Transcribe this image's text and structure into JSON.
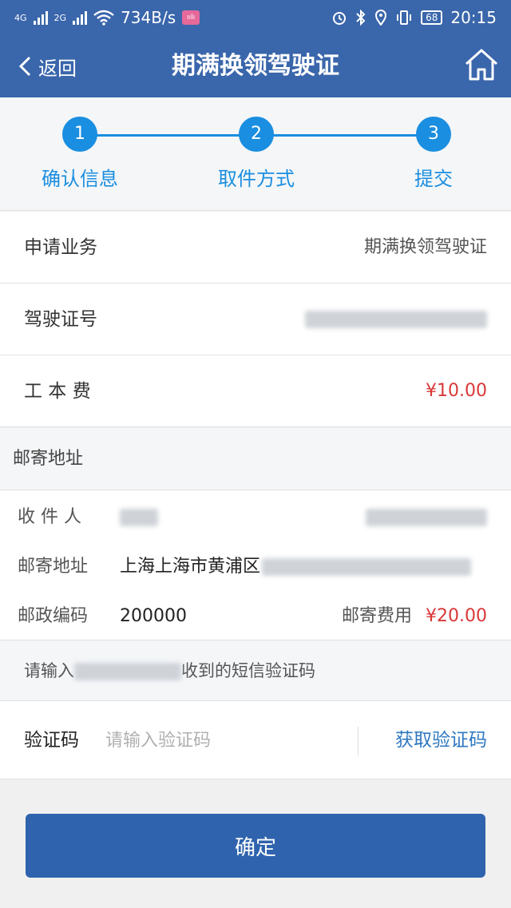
{
  "status_bar": {
    "signal1": "4G",
    "signal2": "2G",
    "speed": "734B/s",
    "battery": "68",
    "time": "20:15"
  },
  "nav": {
    "back_label": "返回",
    "title": "期满换领驾驶证"
  },
  "steps": [
    {
      "number": "1",
      "label": "确认信息"
    },
    {
      "number": "2",
      "label": "取件方式"
    },
    {
      "number": "3",
      "label": "提交"
    }
  ],
  "info": {
    "business_label": "申请业务",
    "business_value": "期满换领驾驶证",
    "license_label": "驾驶证号",
    "fee_label": "工 本 费",
    "fee_value": "¥10.00"
  },
  "mailing": {
    "section_title": "邮寄地址",
    "recipient_label": "收 件 人",
    "address_label": "邮寄地址",
    "address_value": "上海上海市黄浦区",
    "postcode_label": "邮政编码",
    "postcode_value": "200000",
    "postage_label": "邮寄费用",
    "postage_value": "¥20.00"
  },
  "sms": {
    "hint_prefix": "请输入",
    "hint_suffix": "收到的短信验证码"
  },
  "code": {
    "label": "验证码",
    "placeholder": "请输入验证码",
    "get_code": "获取验证码"
  },
  "confirm_label": "确定",
  "colors": {
    "header": "#3a66ab",
    "step_accent": "#1a8ee0",
    "price": "#d93838",
    "button": "#2f63ad"
  }
}
